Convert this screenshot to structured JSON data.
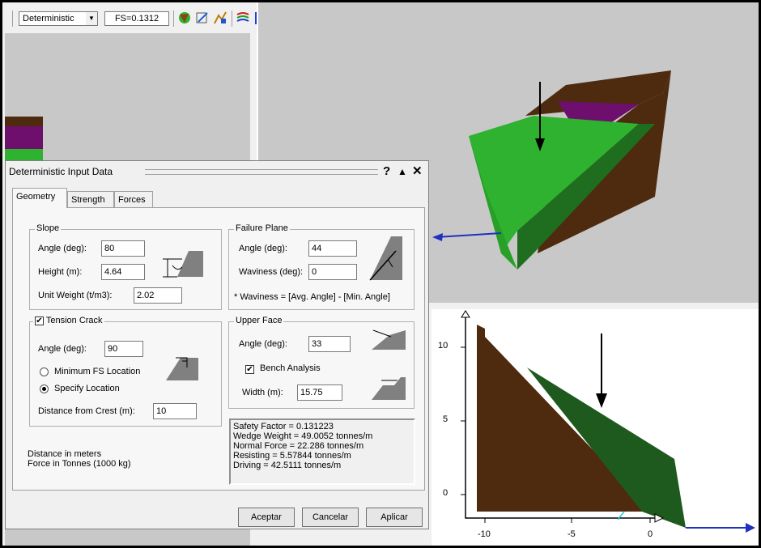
{
  "toolbar": {
    "analysis_mode": "Deterministic",
    "fs_value": "FS=0.1312"
  },
  "dialog": {
    "title": "Deterministic Input Data",
    "help": "?",
    "collapse": "▲",
    "close": "✕",
    "tabs": [
      "Geometry",
      "Strength",
      "Forces"
    ],
    "slope": {
      "caption": "Slope",
      "angle_label": "Angle (deg):",
      "angle": "80",
      "height_label": "Height (m):",
      "height": "4.64",
      "unit_weight_label": "Unit Weight (t/m3):",
      "unit_weight": "2.02"
    },
    "failure_plane": {
      "caption": "Failure Plane",
      "angle_label": "Angle (deg):",
      "angle": "44",
      "waviness_label": "Waviness (deg):",
      "waviness": "0",
      "note": "* Waviness = [Avg. Angle] - [Min. Angle]"
    },
    "tension_crack": {
      "caption": "Tension Crack",
      "checked": true,
      "angle_label": "Angle (deg):",
      "angle": "90",
      "option_min": "Minimum FS Location",
      "option_specify": "Specify Location",
      "distance_label": "Distance from Crest (m):",
      "distance": "10"
    },
    "upper_face": {
      "caption": "Upper Face",
      "angle_label": "Angle (deg):",
      "angle": "33",
      "bench_label": "Bench Analysis",
      "bench_checked": true,
      "width_label": "Width (m):",
      "width": "15.75"
    },
    "units": [
      "Distance in meters",
      "Force in Tonnes (1000 kg)"
    ],
    "results": [
      "Safety Factor = 0.131223",
      "Wedge Weight = 49.0052 tonnes/m",
      "Normal Force = 22.286 tonnes/m",
      "Resisting = 5.57844 tonnes/m",
      "Driving = 42.5111 tonnes/m"
    ],
    "buttons": {
      "ok": "Aceptar",
      "cancel": "Cancelar",
      "apply": "Aplicar"
    }
  },
  "section_view": {
    "y_ticks": [
      "10",
      "5",
      "0"
    ],
    "x_ticks": [
      "-10",
      "-5",
      "0"
    ]
  },
  "colors": {
    "rock": "#4e2a0e",
    "wedge": "#2fb22f",
    "wedge_dark": "#1f6e1f",
    "bench": "#6e0f6e",
    "section_wedge": "#1e5a1e",
    "background": "#c8c8c8"
  }
}
